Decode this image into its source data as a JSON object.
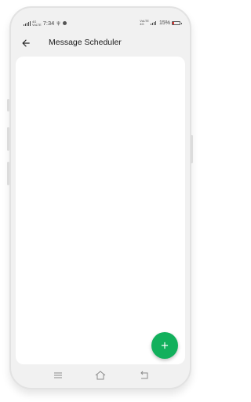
{
  "status_bar": {
    "network_left": "4G",
    "network_left_sub": "VoLTE",
    "time": "7:34",
    "network_right_top": "VoLTE",
    "network_right_bottom": "4G",
    "battery_percent": "15%",
    "battery_level": 0.15,
    "icons": [
      "signal-icon",
      "whatsapp-notification-icon",
      "battery-icon"
    ]
  },
  "app_bar": {
    "title": "Message Scheduler",
    "back_icon": "arrow-left-icon"
  },
  "fab": {
    "icon": "plus-icon",
    "color": "#12b05c"
  },
  "nav_bar": {
    "icons": [
      "menu-icon",
      "home-icon",
      "back-nav-icon"
    ]
  }
}
